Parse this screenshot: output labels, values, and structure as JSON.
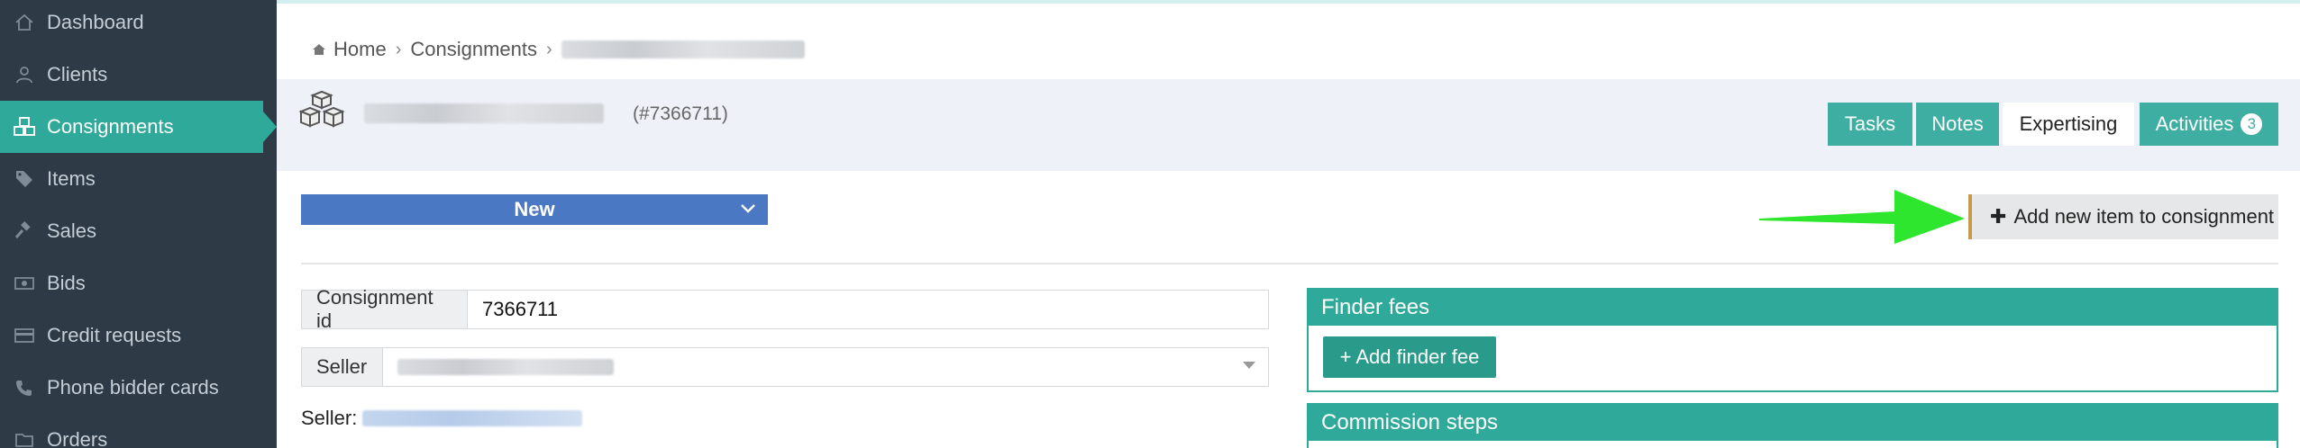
{
  "sidebar": {
    "items": [
      {
        "label": "Dashboard",
        "icon": "home-icon"
      },
      {
        "label": "Clients",
        "icon": "user-icon"
      },
      {
        "label": "Consignments",
        "icon": "boxes-icon"
      },
      {
        "label": "Items",
        "icon": "tags-icon"
      },
      {
        "label": "Sales",
        "icon": "gavel-icon"
      },
      {
        "label": "Bids",
        "icon": "money-icon"
      },
      {
        "label": "Credit requests",
        "icon": "credit-card-icon"
      },
      {
        "label": "Phone bidder cards",
        "icon": "phone-icon"
      },
      {
        "label": "Orders",
        "icon": "folder-icon"
      }
    ],
    "active_index": 2
  },
  "breadcrumb": {
    "home": "Home",
    "consignments": "Consignments"
  },
  "consignment": {
    "id_display": "(#7366711)"
  },
  "tabs": {
    "tasks": "Tasks",
    "notes": "Notes",
    "expertising": "Expertising",
    "activities": "Activities",
    "activities_count": "3"
  },
  "status": {
    "value": "New"
  },
  "actions": {
    "add_item": "Add new item to consignment"
  },
  "form": {
    "consignment_id_label": "Consignment id",
    "consignment_id_value": "7366711",
    "seller_label": "Seller",
    "seller_link_label": "Seller:"
  },
  "finder_fees": {
    "title": "Finder fees",
    "add_button": "+ Add finder fee"
  },
  "commission_steps": {
    "title": "Commission steps"
  },
  "colors": {
    "sidebar_bg": "#2e3a46",
    "accent": "#2fa99a",
    "status_blue": "#4a78c2",
    "arrow_green": "#2ee62e"
  }
}
